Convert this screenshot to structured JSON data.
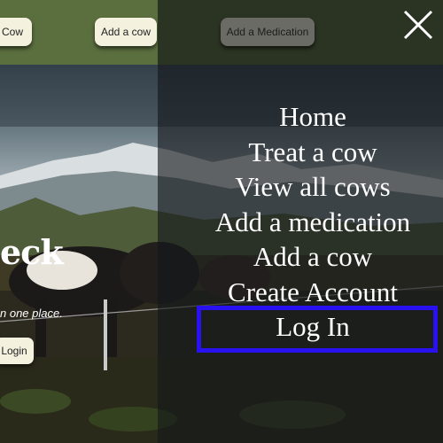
{
  "header": {
    "cow_button_label": "Cow",
    "add_cow_button_label": "Add a cow",
    "add_medication_button_label": "Add a Medication"
  },
  "hero": {
    "title": "eck",
    "tagline": "n one place.",
    "login_button_label": "Login"
  },
  "nav_menu": {
    "items": [
      {
        "label": "Home"
      },
      {
        "label": "Treat a cow"
      },
      {
        "label": "View all cows"
      },
      {
        "label": "Add a medication"
      },
      {
        "label": "Add a cow"
      },
      {
        "label": "Create Account"
      },
      {
        "label": "Log In"
      }
    ],
    "highlighted_item": "Log In",
    "highlight_color": "#2a12f0",
    "close_icon": "close-icon"
  },
  "colors": {
    "header": "#5a6e3e",
    "button_bg": "#f5f1df",
    "overlay": "#14161a"
  }
}
